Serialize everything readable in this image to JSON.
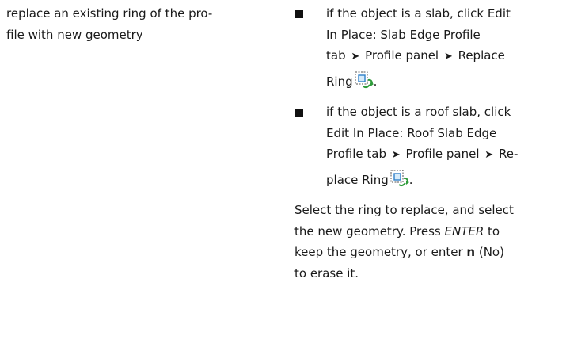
{
  "left": {
    "line1": "replace an existing ring of the pro-",
    "line2": "file with new geometry"
  },
  "bullets": [
    {
      "line1": "if the object is a slab, click Edit",
      "line2": "In Place: Slab Edge Profile",
      "tab_text": "tab",
      "panel_text": "Profile panel",
      "cmd_pre": "Replace",
      "cmd_post": "Ring",
      "icon": "replace-ring-icon",
      "period": "."
    },
    {
      "line1": "if the object is a roof slab, click",
      "line2": "Edit In Place: Roof Slab Edge",
      "tab_text": "Profile tab",
      "panel_text": "Profile panel",
      "cmd_pre": "Re-",
      "cmd_post": "place Ring",
      "icon": "replace-ring-icon",
      "period": "."
    }
  ],
  "arrow": "➤",
  "note": {
    "line1": "Select the ring to replace, and select",
    "line2_pre": "the new geometry. Press ",
    "enter": "ENTER",
    "line2_post": " to",
    "line3_pre": "keep the geometry, or enter ",
    "n": "n",
    "line3_post": " (No)",
    "line4": "to erase it."
  }
}
